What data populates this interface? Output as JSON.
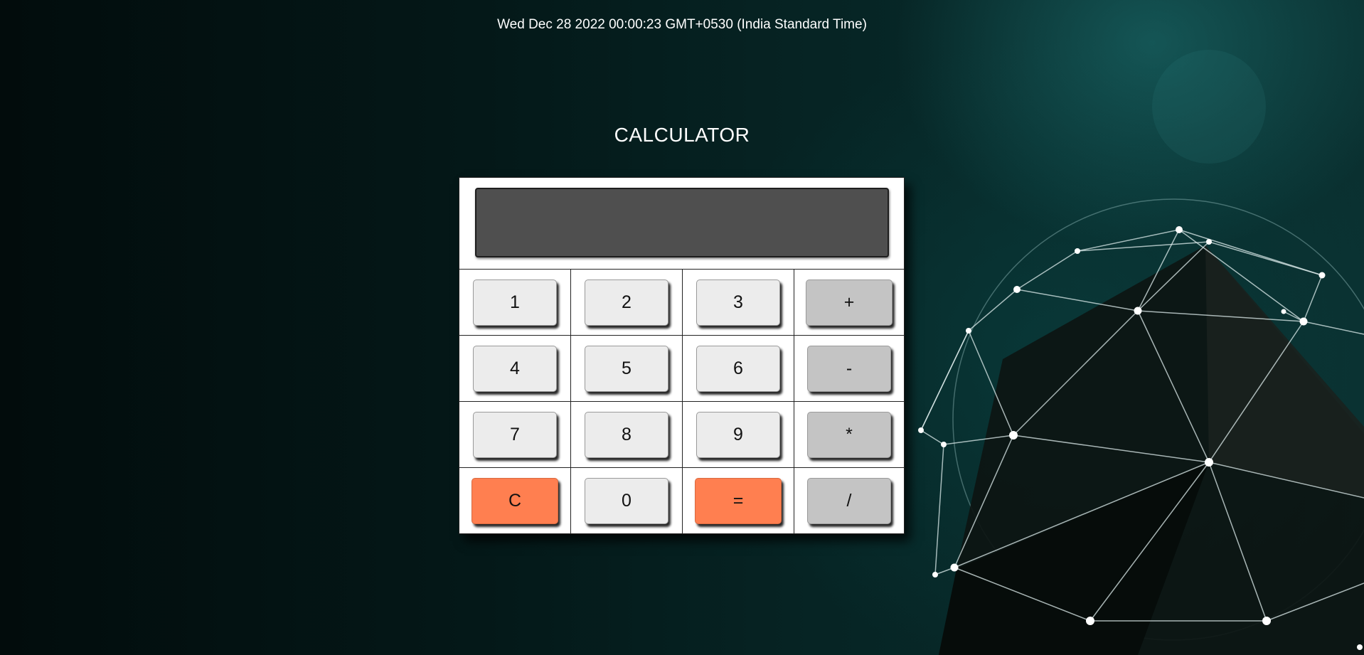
{
  "header": {
    "datetime": "Wed Dec 28 2022 00:00:23 GMT+0530 (India Standard Time)"
  },
  "title": "CALCULATOR",
  "display": {
    "value": ""
  },
  "keys": {
    "k1": "1",
    "k2": "2",
    "k3": "3",
    "plus": "+",
    "k4": "4",
    "k5": "5",
    "k6": "6",
    "minus": "-",
    "k7": "7",
    "k8": "8",
    "k9": "9",
    "multiply": "*",
    "clear": "C",
    "k0": "0",
    "equals": "=",
    "divide": "/"
  },
  "colors": {
    "accent": "#ff7f50",
    "key": "#ececec",
    "operator_key": "#c4c4c4",
    "display": "#4f4f4f"
  }
}
